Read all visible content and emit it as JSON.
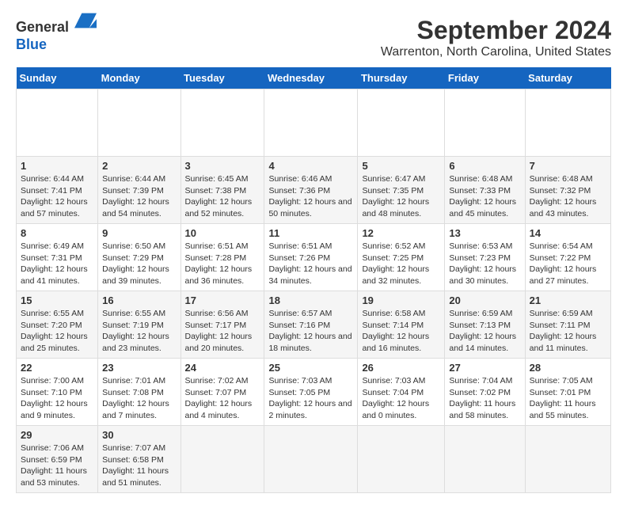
{
  "header": {
    "logo_line1": "General",
    "logo_line2": "Blue",
    "title": "September 2024",
    "subtitle": "Warrenton, North Carolina, United States"
  },
  "calendar": {
    "days_of_week": [
      "Sunday",
      "Monday",
      "Tuesday",
      "Wednesday",
      "Thursday",
      "Friday",
      "Saturday"
    ],
    "weeks": [
      [
        null,
        null,
        null,
        null,
        null,
        null,
        null
      ]
    ]
  },
  "cells": {
    "week1": [
      {
        "num": "",
        "empty": true
      },
      {
        "num": "",
        "empty": true
      },
      {
        "num": "",
        "empty": true
      },
      {
        "num": "",
        "empty": true
      },
      {
        "num": "",
        "empty": true
      },
      {
        "num": "",
        "empty": true
      },
      {
        "num": "",
        "empty": true
      }
    ]
  }
}
